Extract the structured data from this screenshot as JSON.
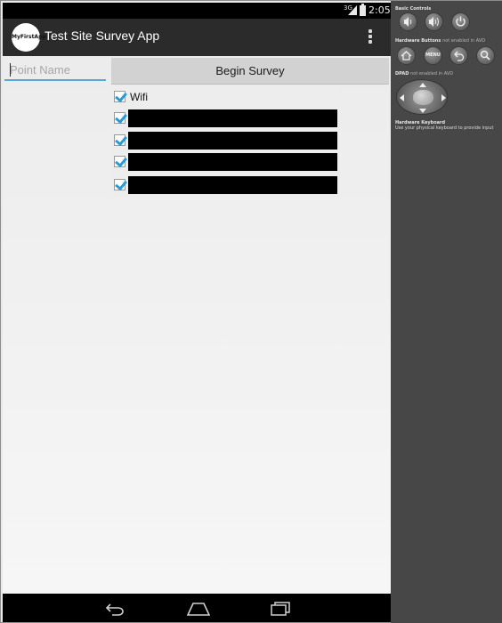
{
  "status_bar": {
    "network": "3G",
    "time": "2:05"
  },
  "action_bar": {
    "app_icon_text": "MyFirstApp",
    "title": "Test Site Survey App"
  },
  "form": {
    "point_name_placeholder": "Point Name",
    "point_name_value": "",
    "begin_button_label": "Begin Survey"
  },
  "networks": [
    {
      "label": "Wifi",
      "checked": true,
      "redacted": false
    },
    {
      "label": "",
      "checked": true,
      "redacted": true
    },
    {
      "label": "",
      "checked": true,
      "redacted": true
    },
    {
      "label": "",
      "checked": true,
      "redacted": true
    },
    {
      "label": "",
      "checked": true,
      "redacted": true
    }
  ],
  "navigation": {
    "back_icon": "back-icon",
    "home_icon": "home-icon",
    "recent_icon": "recent-apps-icon"
  },
  "emulator_panel": {
    "basic_controls_label": "Basic Controls",
    "hardware_buttons_label": "Hardware Buttons",
    "hardware_buttons_note": "not enabled in AVD",
    "menu_label": "MENU",
    "dpad_label": "DPAD",
    "dpad_note": "not enabled in AVD",
    "keyboard_label": "Hardware Keyboard",
    "keyboard_note": "Use your physical keyboard to provide input"
  }
}
